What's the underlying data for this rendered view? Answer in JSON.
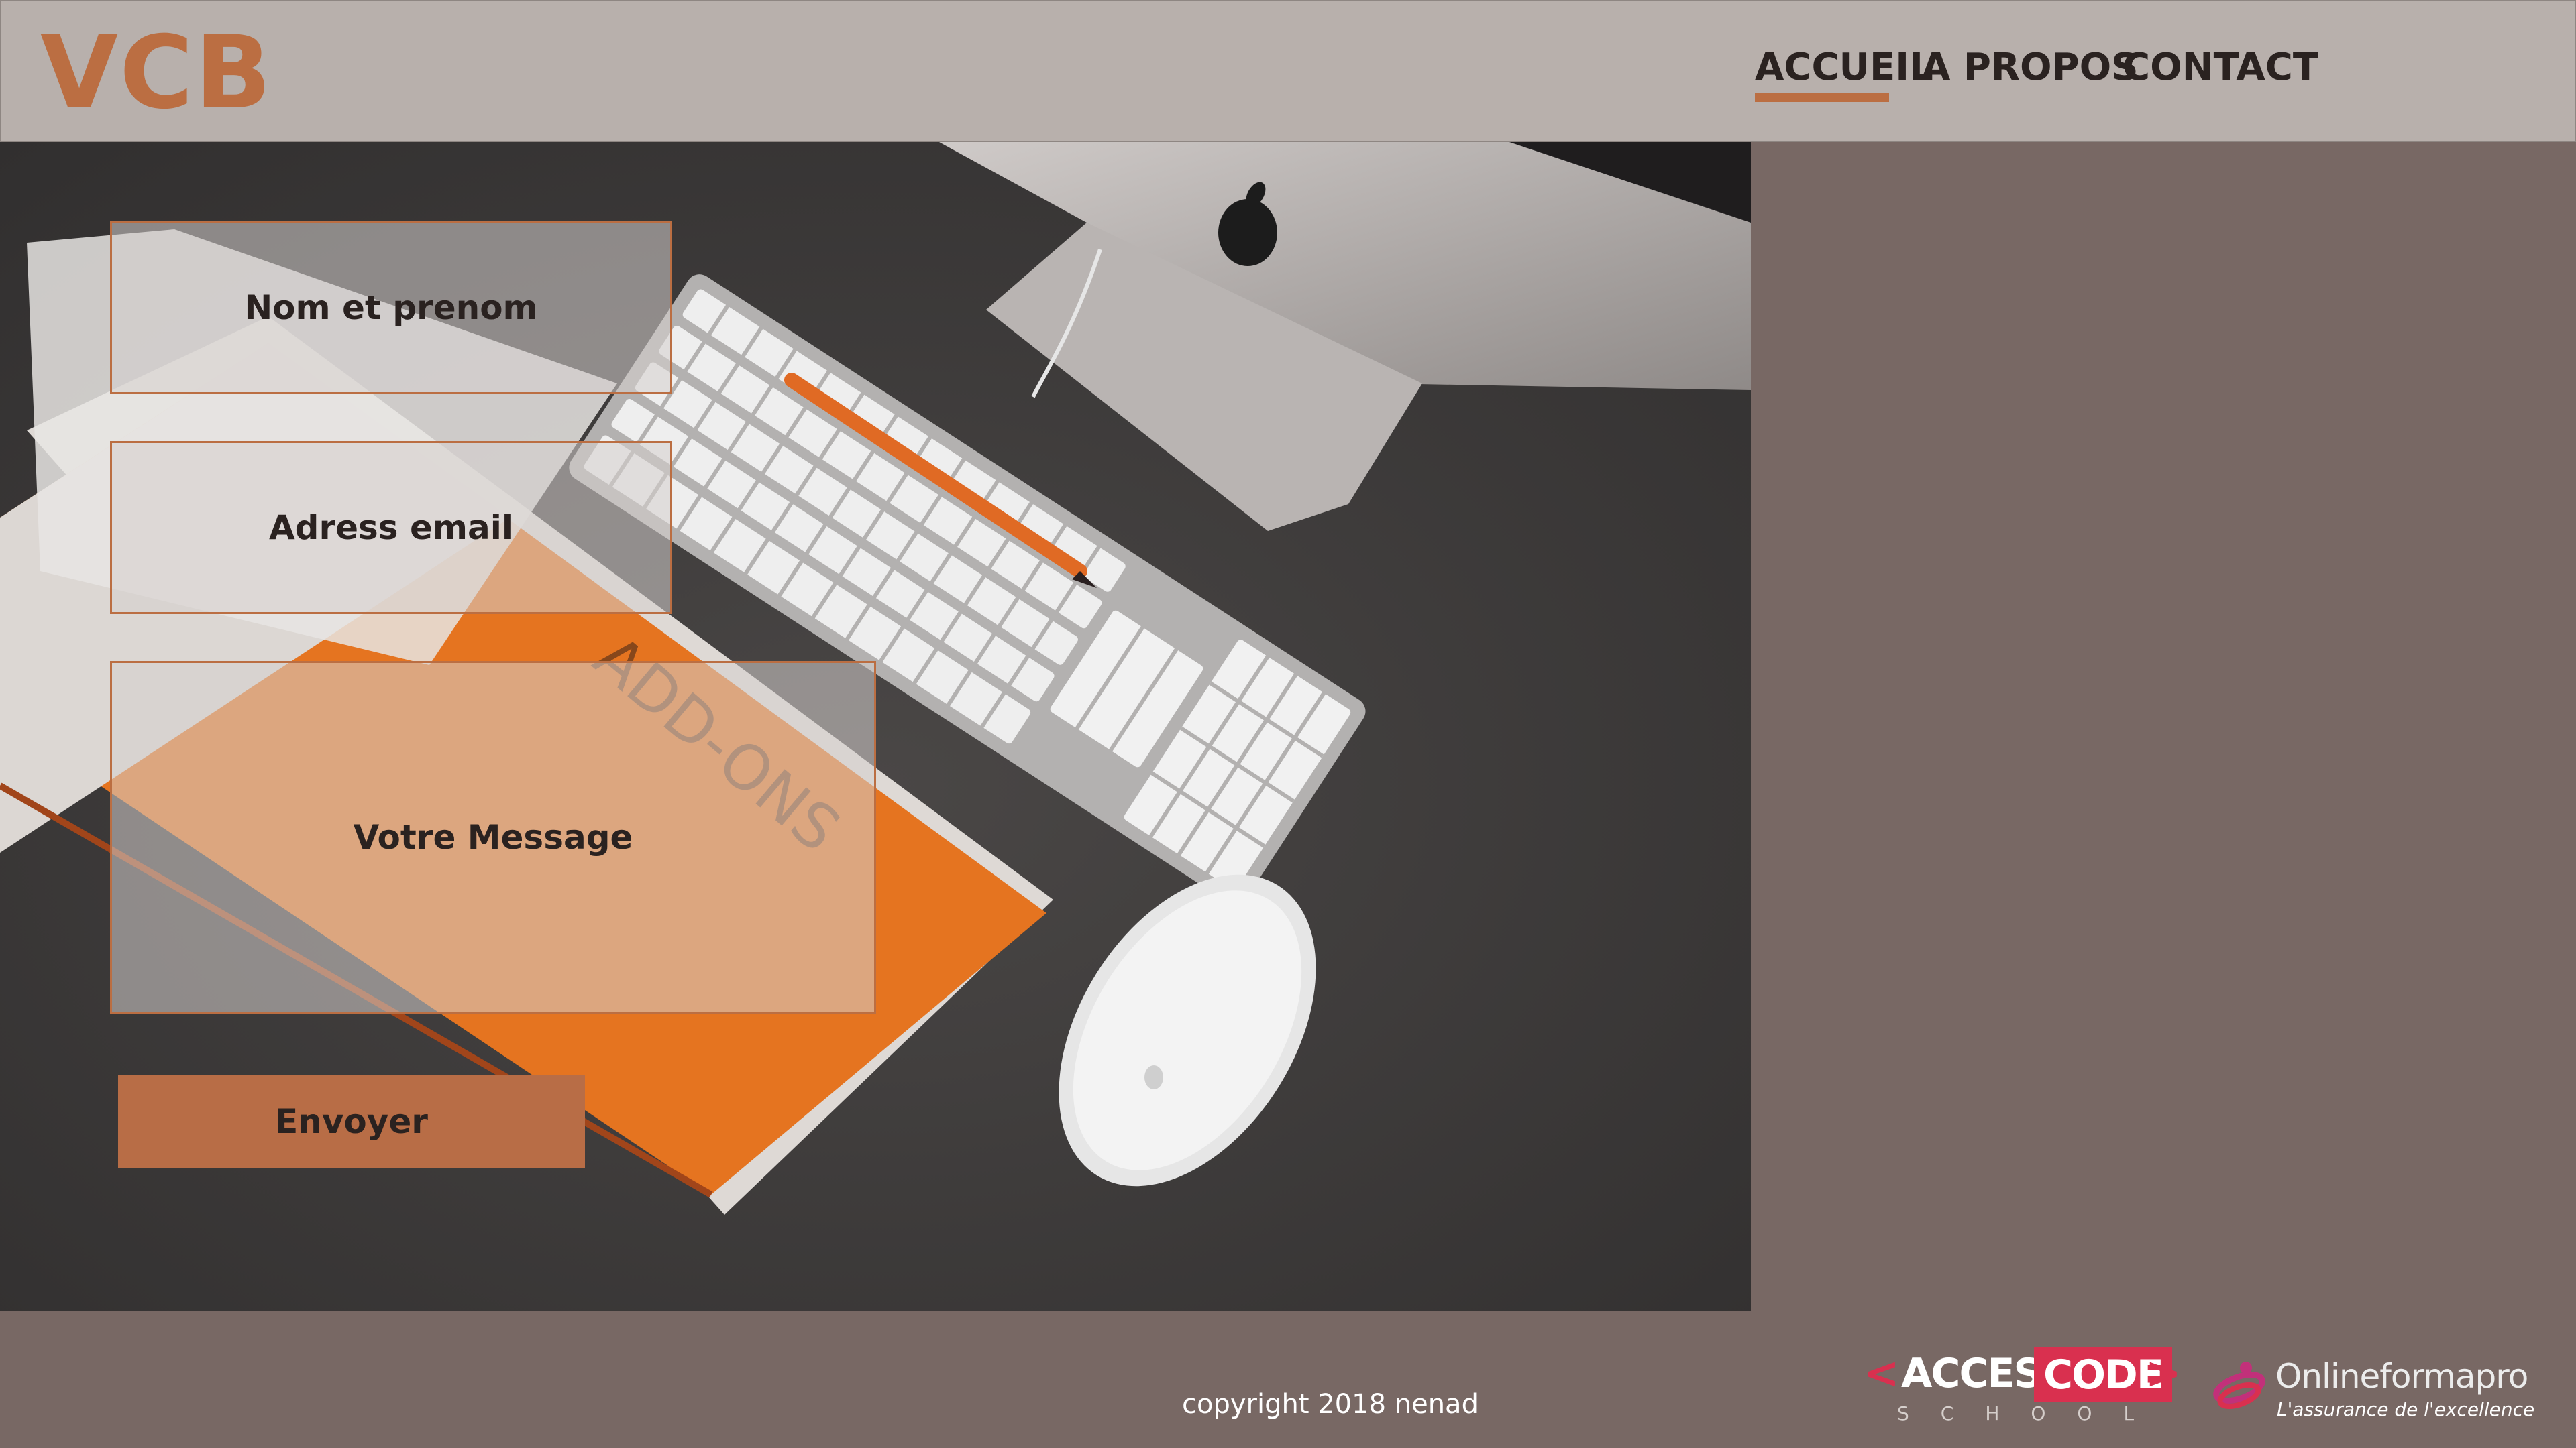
{
  "header": {
    "logo": "VCB",
    "nav": [
      {
        "label": "ACCUEIL",
        "active": true
      },
      {
        "label": "A PROPOS",
        "active": false
      },
      {
        "label": "CONTACT",
        "active": false
      }
    ]
  },
  "hero": {
    "book_title": "ADD-ONS"
  },
  "form": {
    "name_placeholder": "Nom et prenom",
    "email_placeholder": "Adress email",
    "message_placeholder": "Votre Message",
    "submit_label": "Envoyer"
  },
  "footer": {
    "copyright": "copyright 2018 nenad",
    "access_code": {
      "bracket_left": "<",
      "access": "ACCESS",
      "code": "CODE",
      "bracket_right": ">",
      "school": "SCHOOL"
    },
    "onlineformapro": {
      "name": "Onlineformapro",
      "tagline": "L'assurance de l'excellence"
    }
  },
  "colors": {
    "accent": "#bb6e42",
    "header_bg": "#b8b0ac",
    "page_bg": "#786864",
    "access_code_red": "#d9304f"
  },
  "icons": [
    "apple-logo-icon",
    "orange-pencil-icon"
  ]
}
